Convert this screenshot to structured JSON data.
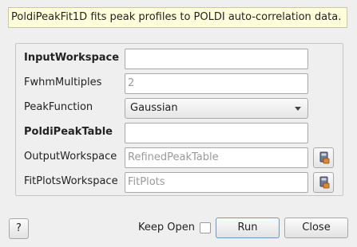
{
  "description": "PoldiPeakFit1D fits peak profiles to POLDI auto-correlation data.",
  "fields": {
    "input_workspace": {
      "label": "InputWorkspace",
      "value": ""
    },
    "fwhm_multiples": {
      "label": "FwhmMultiples",
      "placeholder": "2"
    },
    "peak_function": {
      "label": "PeakFunction",
      "value": "Gaussian"
    },
    "poldi_peak_table": {
      "label": "PoldiPeakTable",
      "value": ""
    },
    "output_workspace": {
      "label": "OutputWorkspace",
      "placeholder": "RefinedPeakTable"
    },
    "fit_plots_workspace": {
      "label": "FitPlotsWorkspace",
      "placeholder": "FitPlots"
    }
  },
  "footer": {
    "help_label": "?",
    "keep_open_label": "Keep Open",
    "run_label": "Run",
    "close_label": "Close"
  },
  "icons": {
    "workspace_picker": "save-workspace-icon"
  }
}
